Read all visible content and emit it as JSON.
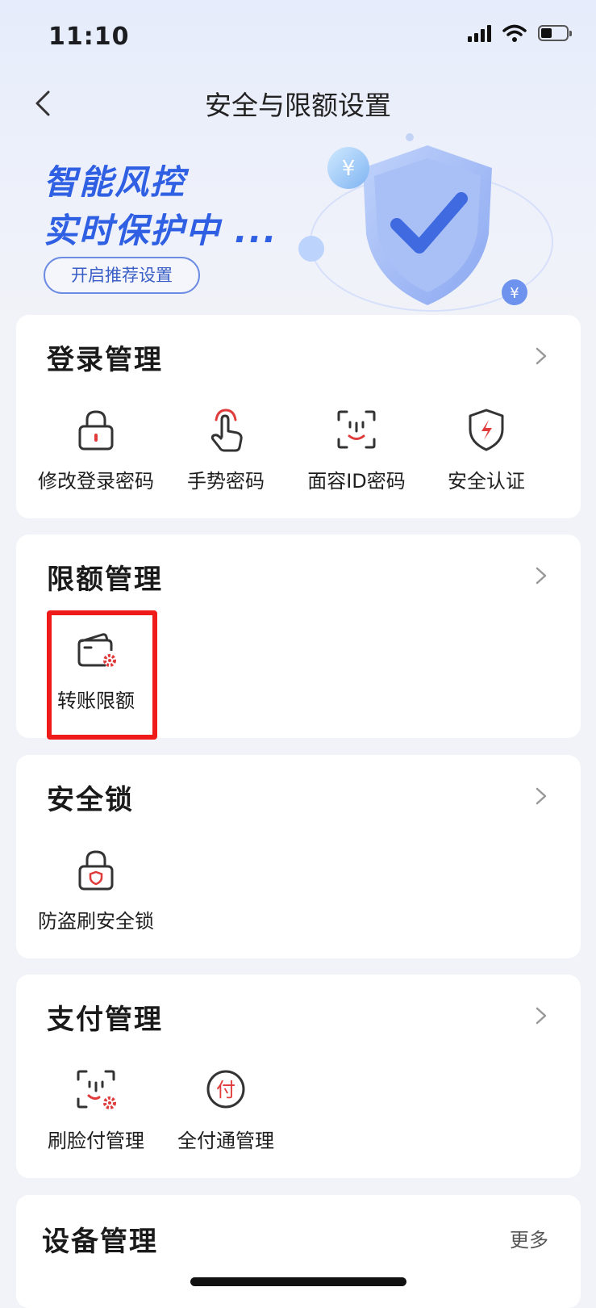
{
  "status_bar": {
    "time": "11:10",
    "battery_level": 0.45
  },
  "nav": {
    "title": "安全与限额设置"
  },
  "banner": {
    "line1": "智能风控",
    "line2": "实时保护中 ...",
    "button_label": "开启推荐设置"
  },
  "login": {
    "title": "登录管理",
    "items": [
      {
        "label": "修改登录密码",
        "icon": "lock-icon"
      },
      {
        "label": "手势密码",
        "icon": "gesture-icon"
      },
      {
        "label": "面容ID密码",
        "icon": "face-id-icon"
      },
      {
        "label": "安全认证",
        "icon": "shield-bolt-icon"
      }
    ]
  },
  "limit": {
    "title": "限额管理",
    "items": [
      {
        "label": "转账限额",
        "icon": "wallet-settings-icon"
      }
    ]
  },
  "security_lock": {
    "title": "安全锁",
    "items": [
      {
        "label": "防盗刷安全锁",
        "icon": "lock-shield-icon"
      }
    ]
  },
  "payment": {
    "title": "支付管理",
    "items": [
      {
        "label": "刷脸付管理",
        "icon": "face-pay-icon"
      },
      {
        "label": "全付通管理",
        "icon": "pay-circle-icon"
      }
    ],
    "pay_glyph": "付"
  },
  "device": {
    "title": "设备管理",
    "more_label": "更多"
  },
  "colors": {
    "accent_red": "#e03b3b",
    "brand_blue": "#2f5fe3",
    "highlight": "#ef1a1a"
  }
}
